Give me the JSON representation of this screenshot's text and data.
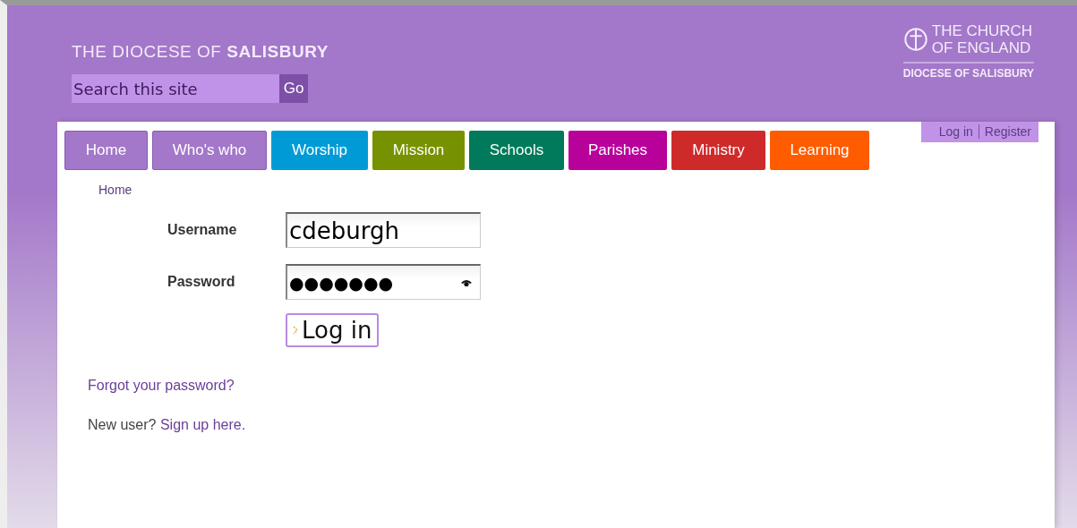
{
  "header": {
    "title": "THE DIOCESE OF **SALISBURY**",
    "search": {
      "placeholder": "Search this site",
      "button": "Go"
    },
    "logo": {
      "line_1": "THE CHURCH",
      "line_2": "OF ENGLAND",
      "line_3": "DIOCESE OF SALISBURY"
    }
  },
  "account_links": [
    "Log in",
    "Register"
  ],
  "nav": [
    {
      "label": "Home",
      "color": "#a377c9"
    },
    {
      "label": "Who's who",
      "color": "#a377c9"
    },
    {
      "label": "Worship",
      "color": "#009bd6"
    },
    {
      "label": "Mission",
      "color": "#779200"
    },
    {
      "label": "Schools",
      "color": "#007a5a"
    },
    {
      "label": "Parishes",
      "color": "#b8009a"
    },
    {
      "label": "Ministry",
      "color": "#cf2a2a"
    },
    {
      "label": "Learning",
      "color": "#ff5c00"
    }
  ],
  "breadcrumb": "Home",
  "form": {
    "username_label": "Username",
    "username": "cdeburgh",
    "password_label": "Password",
    "password": "●●●●●●●",
    "submit": "Log in"
  },
  "forgot_link": "Forgot your password?",
  "signup": {
    "text": "New user?",
    "link": "Sign up here."
  }
}
